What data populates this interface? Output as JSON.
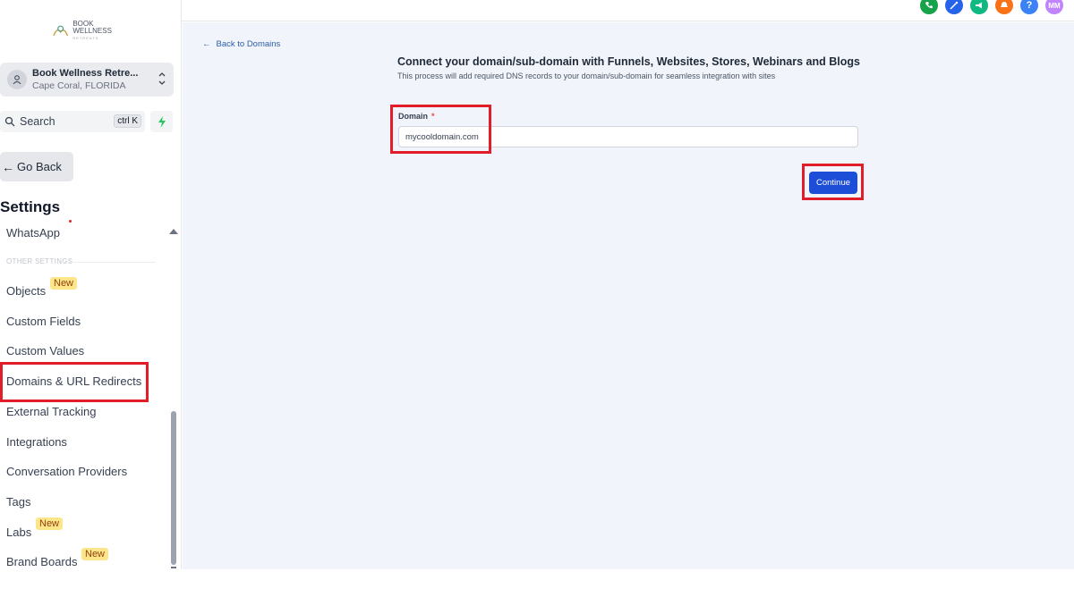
{
  "brand": {
    "line1": "BOOK WELLNESS",
    "line2": "RETREATS"
  },
  "account": {
    "name": "Book Wellness Retre...",
    "location": "Cape Coral, FLORIDA"
  },
  "search": {
    "label": "Search",
    "shortcut": "ctrl K"
  },
  "sidebar": {
    "go_back": "Go Back",
    "settings_title": "Settings",
    "section_other": "OTHER SETTINGS",
    "items": [
      {
        "label": "WhatsApp"
      },
      {
        "label": "Objects",
        "badge": "New"
      },
      {
        "label": "Custom Fields"
      },
      {
        "label": "Custom Values"
      },
      {
        "label": "Domains & URL Redirects"
      },
      {
        "label": "External Tracking"
      },
      {
        "label": "Integrations"
      },
      {
        "label": "Conversation Providers"
      },
      {
        "label": "Tags"
      },
      {
        "label": "Labs",
        "badge": "New"
      },
      {
        "label": "Brand Boards",
        "badge": "New"
      }
    ]
  },
  "topbar": {
    "icons": [
      {
        "name": "phone-icon",
        "color": "#16a34a"
      },
      {
        "name": "magic-icon",
        "color": "#2563eb"
      },
      {
        "name": "megaphone-icon",
        "color": "#10b981"
      },
      {
        "name": "bell-icon",
        "color": "#f97316"
      },
      {
        "name": "help-icon",
        "color": "#3b82f6",
        "glyph": "?"
      },
      {
        "name": "user-avatar",
        "color": "#c084fc",
        "glyph": "MM"
      }
    ]
  },
  "main": {
    "back_link": "Back to Domains",
    "heading": "Connect your domain/sub-domain with Funnels, Websites, Stores, Webinars and Blogs",
    "subheading": "This process will add required DNS records to your domain/sub-domain for seamless integration with sites",
    "domain_label": "Domain",
    "required_mark": "*",
    "domain_value": "mycooldomain.com",
    "continue_label": "Continue"
  },
  "colors": {
    "accent": "#1d4ed8",
    "highlight": "#e11d2a",
    "main_bg": "#f1f5fb"
  }
}
